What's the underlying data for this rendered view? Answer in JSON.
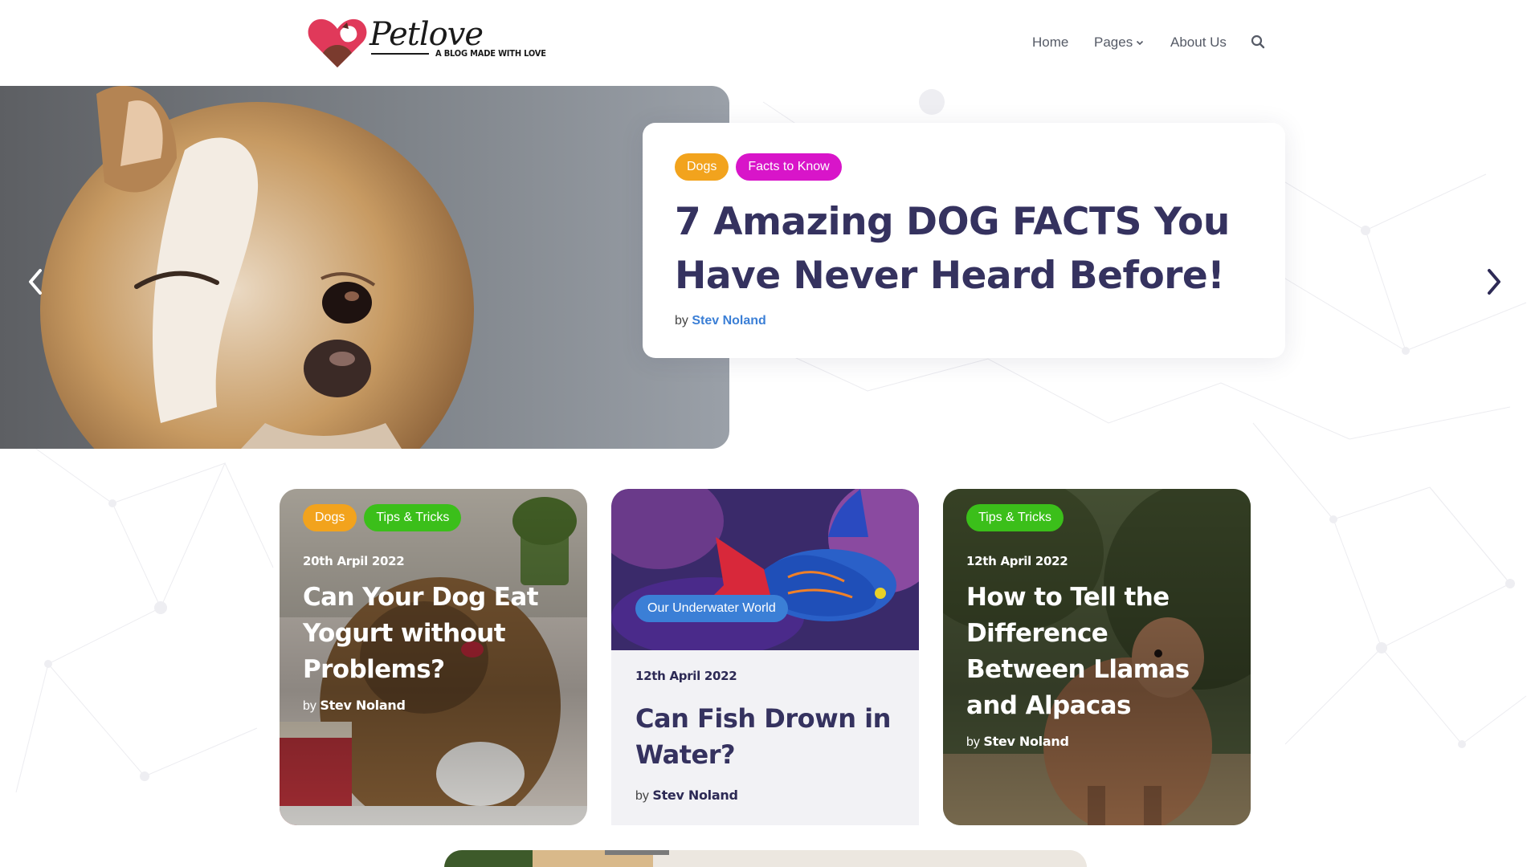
{
  "brand": {
    "name": "Petlove",
    "tagline": "A BLOG MADE WITH LOVE"
  },
  "nav": {
    "home": "Home",
    "pages": "Pages",
    "about": "About Us",
    "search_icon": "search-icon"
  },
  "hero": {
    "tags": [
      "Dogs",
      "Facts to Know"
    ],
    "title": "7 Amazing DOG FACTS You Have Never Heard Before!",
    "by_prefix": "by",
    "author": "Stev Noland",
    "prev_icon": "chevron-left-icon",
    "next_icon": "chevron-right-icon"
  },
  "cards": [
    {
      "tags": [
        "Dogs",
        "Tips & Tricks"
      ],
      "date": "20th Arpil 2022",
      "title": "Can Your Dog Eat Yogurt without Problems?",
      "by_prefix": "by",
      "author": "Stev Noland"
    },
    {
      "tags": [
        "Our Underwater World"
      ],
      "date": "12th April 2022",
      "title": "Can Fish Drown in Water?",
      "by_prefix": "by",
      "author": "Stev Noland"
    },
    {
      "tags": [
        "Tips & Tricks"
      ],
      "date": "12th April 2022",
      "title": "How to Tell the Difference Between Llamas and Alpacas",
      "by_prefix": "by",
      "author": "Stev Noland"
    }
  ],
  "colors": {
    "dogs_tag": "#f2a31d",
    "facts_tag": "#d815c9",
    "tips_tag": "#3bbf1a",
    "underwater_tag": "#3b7fd6",
    "title_navy": "#35325f",
    "author_blue": "#3b7fd6"
  }
}
